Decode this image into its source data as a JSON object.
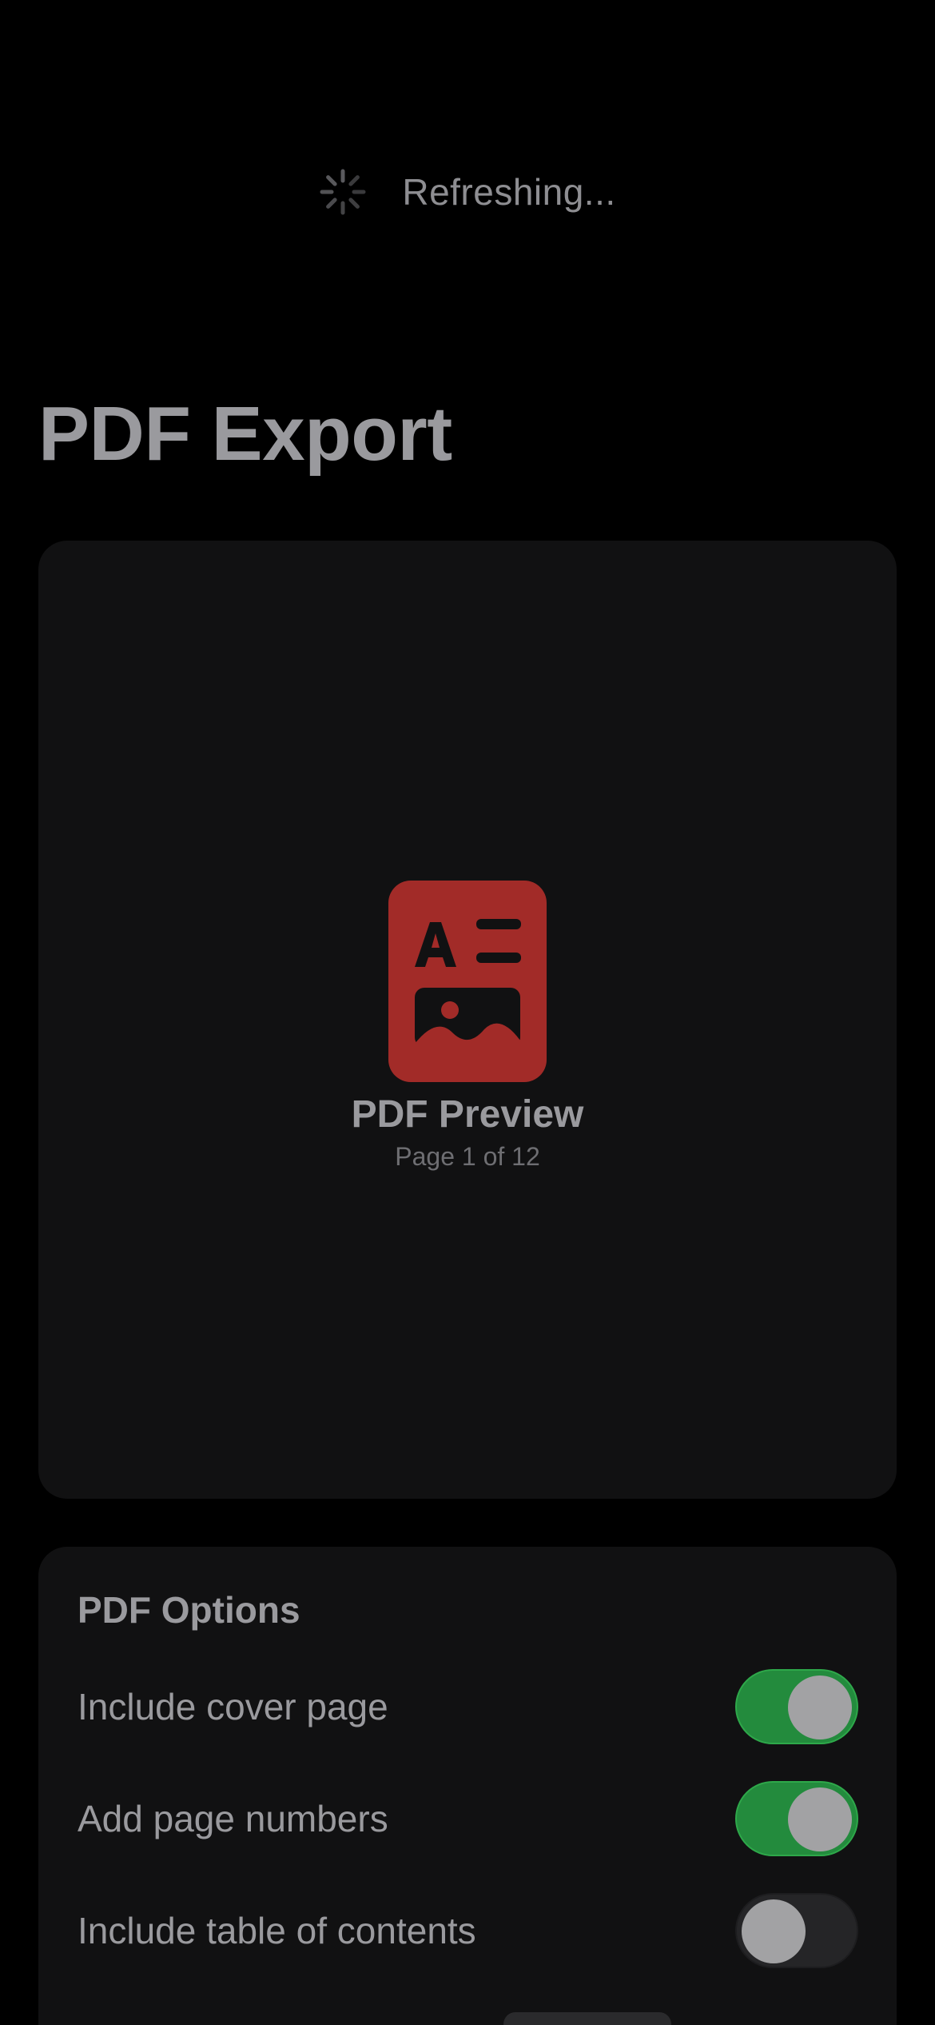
{
  "refresh": {
    "text": "Refreshing...",
    "icon": "spinner-icon"
  },
  "page": {
    "title": "PDF Export"
  },
  "preview": {
    "icon": "pdf-document-icon",
    "title": "PDF Preview",
    "subtitle": "Page 1 of 12",
    "accent_color": "#a22b28"
  },
  "options": {
    "title": "PDF Options",
    "items": [
      {
        "label": "Include cover page",
        "enabled": true
      },
      {
        "label": "Add page numbers",
        "enabled": true
      },
      {
        "label": "Include table of contents",
        "enabled": false
      }
    ]
  },
  "colors": {
    "background": "#000000",
    "card": "#111112",
    "toggle_on": "#238b3d",
    "toggle_off": "#252527"
  }
}
